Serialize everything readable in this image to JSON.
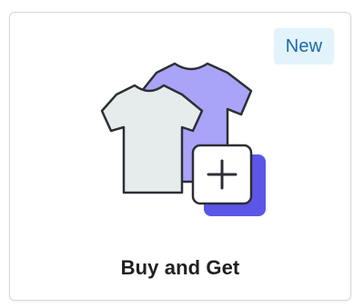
{
  "card": {
    "title": "Buy and Get",
    "badge": "New"
  },
  "icons": {
    "illustration": "two-shirts-plus-icon"
  },
  "colors": {
    "badge_bg": "#e3f3fb",
    "badge_text": "#1a6aa8",
    "shirt_back": "#a9a4f8",
    "shirt_front": "#e6ecec",
    "plus_shadow": "#5b56e6",
    "outline": "#2d2f35"
  }
}
